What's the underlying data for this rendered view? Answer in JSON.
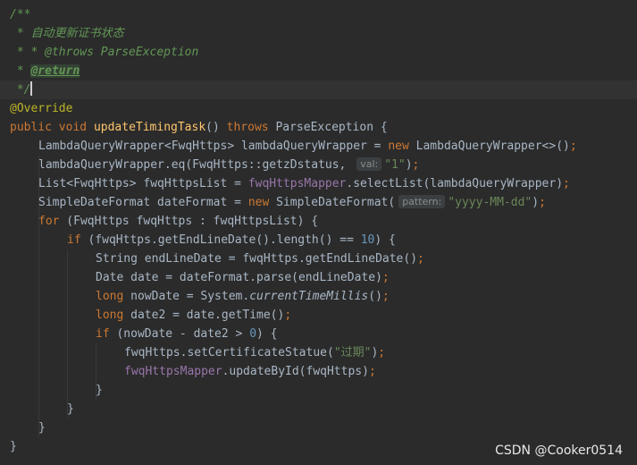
{
  "doc_comment": {
    "open": "/**",
    "description": " * 自动更新证书状态",
    "throws_line": " * * @throws ParseException",
    "return_prefix": " * ",
    "return_tag": "@return",
    "close": " */"
  },
  "code": {
    "annotation": "@Override",
    "sig_public": "public",
    "sig_void": "void",
    "sig_name": "updateTimingTask",
    "sig_paren": "()",
    "sig_throws": "throws",
    "sig_rest": " ParseException {",
    "l1_type": "LambdaQueryWrapper<FwqHttps> lambdaQueryWrapper = ",
    "l1_new": "new",
    "l1_rest": " LambdaQueryWrapper<>()",
    "l2_code": "lambdaQueryWrapper.eq(FwqHttps::getzDstatus, ",
    "l2_hint": "val:",
    "l2_str": "\"1\"",
    "l2_end": ")",
    "l3_code": "List<FwqHttps> fwqHttpsList = ",
    "l3_field": "fwqHttpsMapper",
    "l3_rest": ".selectList(lambdaQueryWrapper)",
    "l4_code": "SimpleDateFormat dateFormat = ",
    "l4_new": "new",
    "l4_rest": " SimpleDateFormat(",
    "l4_hint": "pattern:",
    "l4_str": "\"yyyy-MM-dd\"",
    "l4_end": ")",
    "l5_for": "for",
    "l5_rest": " (FwqHttps fwqHttps : fwqHttpsList) {",
    "l6_if": "if",
    "l6_rest": " (fwqHttps.getEndLineDate().length() == ",
    "l6_num": "10",
    "l6_end": ") {",
    "l7_code": "String endLineDate = fwqHttps.getEndLineDate()",
    "l8_code": "Date date = dateFormat.parse(endLineDate)",
    "l9_long": "long",
    "l9_mid": " nowDate = System.",
    "l9_static": "currentTimeMillis",
    "l9_end": "()",
    "l10_long": "long",
    "l10_rest": " date2 = date.getTime()",
    "l11_if": "if",
    "l11_rest": " (nowDate - date2 > ",
    "l11_num": "0",
    "l11_end": ") {",
    "l12_code": "fwqHttps.setCertificateStatue(",
    "l12_str": "\"过期\"",
    "l12_end": ")",
    "l13_field": "fwqHttpsMapper",
    "l13_rest": ".updateById(fwqHttps)",
    "semicolon": ";",
    "close_brace": "}"
  },
  "watermark": "CSDN @Cooker0514",
  "colors": {
    "background": "#2b2b2b",
    "current_line": "#323232",
    "keyword": "#cc7832",
    "method_declaration": "#ffc66d",
    "field": "#9876aa",
    "number": "#6897bb",
    "string": "#6a8759",
    "comment": "#629755",
    "annotation": "#bbb529",
    "plain": "#a9b7c6"
  }
}
